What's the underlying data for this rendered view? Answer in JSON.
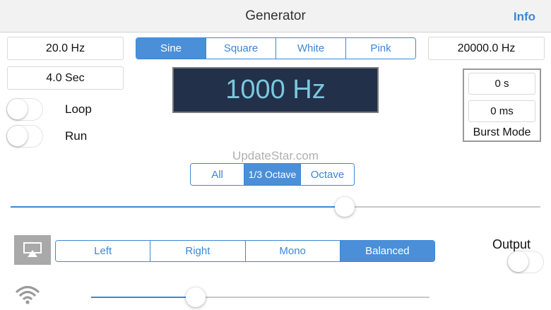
{
  "header": {
    "title": "Generator",
    "info_label": "Info"
  },
  "freq_min": "20.0 Hz",
  "freq_max": "20000.0 Hz",
  "duration": "4.0 Sec",
  "waveform": {
    "options": [
      "Sine",
      "Square",
      "White",
      "Pink"
    ],
    "selected": "Sine"
  },
  "frequency_display": "1000 Hz",
  "loop": {
    "label": "Loop",
    "on": false
  },
  "run": {
    "label": "Run",
    "on": false
  },
  "burst": {
    "on_time": "0 s",
    "off_time": "0 ms",
    "label": "Burst Mode"
  },
  "watermark": "UpdateStar.com",
  "resolution": {
    "options": [
      "All",
      "1/3 Octave",
      "Octave"
    ],
    "selected": "1/3 Octave"
  },
  "frequency_slider_level": 0.63,
  "channel": {
    "options": [
      "Left",
      "Right",
      "Mono",
      "Balanced"
    ],
    "selected": "Balanced"
  },
  "output": {
    "label": "Output",
    "on": false
  },
  "volume_slider_level": 0.31,
  "icons": {
    "airplay": "airplay-icon",
    "wifi": "wifi-icon"
  },
  "colors": {
    "accent": "#3e86d6",
    "display_bg": "#22304a",
    "display_text": "#7cc7dc"
  }
}
